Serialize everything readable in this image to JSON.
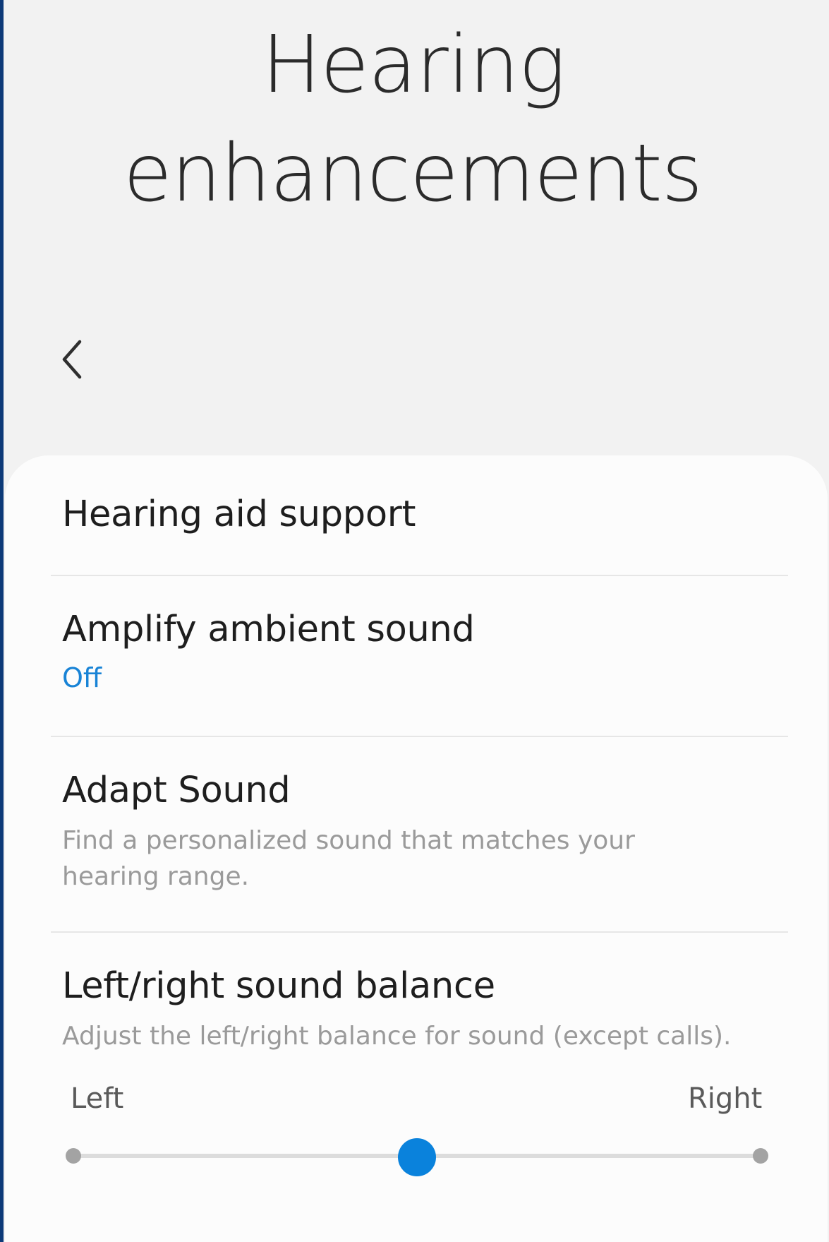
{
  "header": {
    "title_line1": "Hearing",
    "title_line2": "enhancements"
  },
  "items": [
    {
      "title": "Hearing aid support"
    },
    {
      "title": "Amplify ambient sound",
      "status": "Off"
    },
    {
      "title": "Adapt Sound",
      "subtitle_line1": "Find a personalized sound that matches your",
      "subtitle_line2": "hearing range."
    },
    {
      "title": "Left/right sound balance",
      "subtitle": "Adjust the left/right balance for sound (except calls)."
    }
  ],
  "balance": {
    "left_label": "Left",
    "right_label": "Right",
    "value": 0.5
  },
  "colors": {
    "accent": "#0a82dc",
    "status": "#1883d6",
    "background": "#f2f2f2",
    "card": "#fcfcfc"
  },
  "icons": {
    "back": "chevron-left-icon"
  }
}
